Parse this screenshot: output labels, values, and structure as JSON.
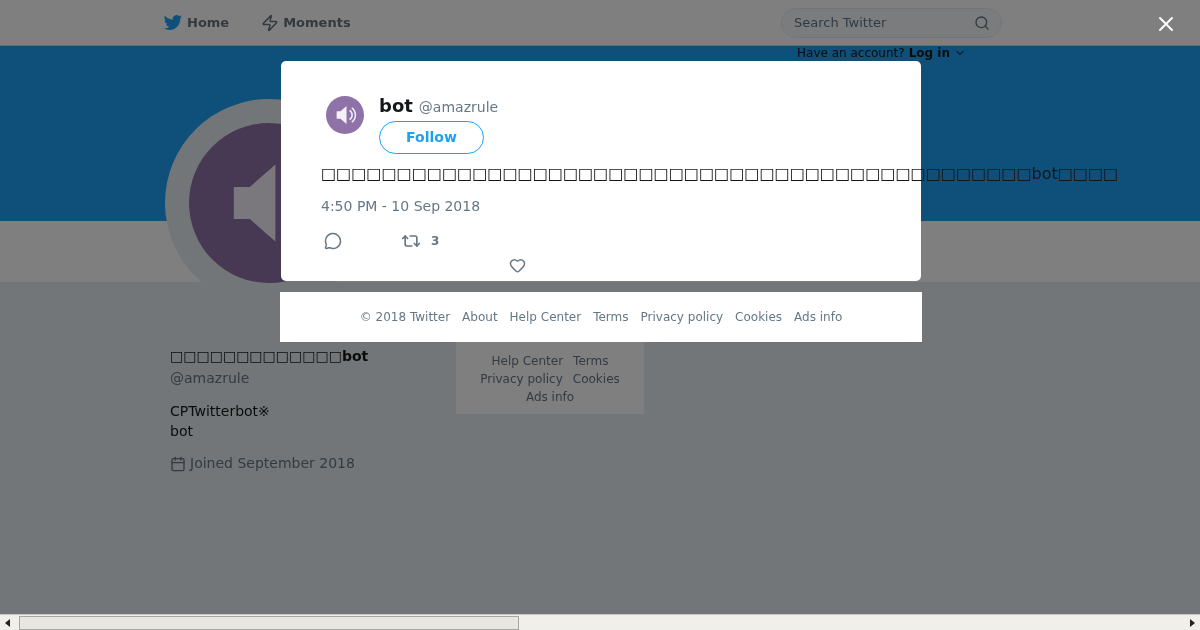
{
  "top_nav": {
    "items": [
      {
        "label": "Home"
      },
      {
        "label": "Moments"
      }
    ],
    "search": {
      "placeholder": "Search Twitter"
    },
    "login_prompt": {
      "text": "Have an account?",
      "link": "Log in"
    }
  },
  "profile": {
    "name": "□□□□□□□□□□□□□bot",
    "handle": "@amazrule",
    "bio": [
      "CPTwitterbot※",
      "bot"
    ],
    "joined": "Joined September 2018"
  },
  "sidebar_footer": [
    "Help Center",
    "Terms",
    "Privacy policy",
    "Cookies",
    "Ads info"
  ],
  "modal": {
    "name": "bot",
    "handle": "@amazrule",
    "follow": "Follow",
    "text": "□□□□□□□□□□□□□□□□□□□□□□□□□□□□□□□□□□□□□□□□□□□□□□□bot□□□□",
    "time": "4:50 PM - 10 Sep 2018",
    "retweets": "3"
  },
  "modal_footer": [
    "© 2018 Twitter",
    "About",
    "Help Center",
    "Terms",
    "Privacy policy",
    "Cookies",
    "Ads info"
  ]
}
